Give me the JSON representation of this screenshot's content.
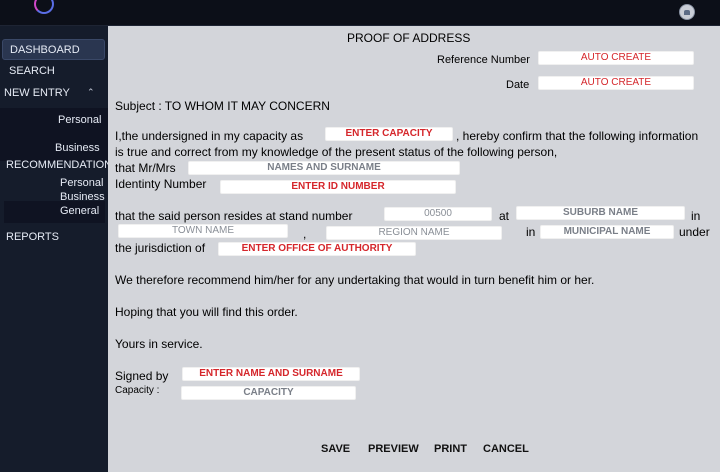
{
  "sidebar": {
    "dashboard": "DASHBOARD",
    "search": "SEARCH",
    "new_entry": "NEW ENTRY",
    "personal": "Personal",
    "business": "Business",
    "recommendations": "RECOMMENDATIONS",
    "rec_personal": "Personal",
    "rec_business": "Business",
    "rec_general": "General",
    "reports": "REPORTS"
  },
  "form": {
    "title": "PROOF OF ADDRESS",
    "reference_label": "Reference Number",
    "reference_value": "AUTO CREATE",
    "date_label": "Date",
    "date_value": "AUTO CREATE",
    "subject": "Subject : TO WHOM IT MAY CONCERN",
    "line1_a": "I,the undersigned in my capacity as",
    "capacity_input": "ENTER CAPACITY",
    "line1_b": ", hereby confirm that the following information",
    "line2": "is true and correct  from my knowledge of the present status of the following person,",
    "that_mr": "that Mr/Mrs",
    "names_input": "NAMES AND SURNAME",
    "id_label": "Identinty Number",
    "id_input": "ENTER ID NUMBER",
    "resides": "that the said person resides at  stand number",
    "stand_number": "00500",
    "at": "at",
    "suburb": "SUBURB NAME",
    "in1": "in",
    "town": "TOWN NAME",
    "comma": ",",
    "region": "REGION NAME",
    "in2": "in",
    "municipal": "MUNICIPAL NAME",
    "under": "under",
    "jurisdiction": "the jurisdiction of",
    "office_input": "ENTER OFFICE OF AUTHORITY",
    "recommend": "We therefore recommend him/her for any undertaking that would in turn benefit him or her.",
    "hoping": "Hoping that you will find this order.",
    "yours": "Yours in service.",
    "signed_by": "Signed by",
    "signed_input": "ENTER NAME AND SURNAME",
    "capacity_label": "Capacity  :",
    "capacity_sign": "CAPACITY"
  },
  "actions": {
    "save": "SAVE",
    "preview": "PREVIEW",
    "print": "PRINT",
    "cancel": "CANCEL"
  },
  "colors": {
    "sidebar": "#151c2b",
    "paper": "#d3d5da",
    "placeholder_red": "#d5262b"
  },
  "icons": [
    "app-logo-icon",
    "user-avatar-icon",
    "chevron-up-icon"
  ]
}
